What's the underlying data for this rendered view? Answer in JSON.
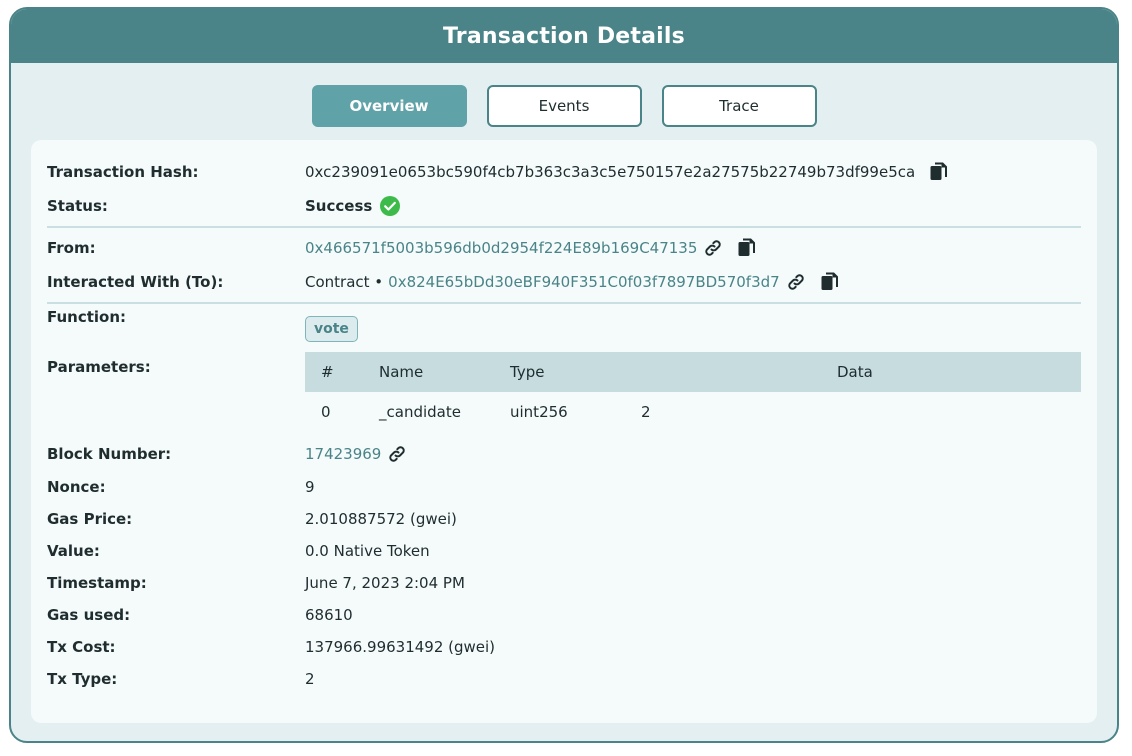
{
  "header": {
    "title": "Transaction Details"
  },
  "tabs": [
    {
      "label": "Overview",
      "active": true
    },
    {
      "label": "Events",
      "active": false
    },
    {
      "label": "Trace",
      "active": false
    }
  ],
  "details": {
    "hash": {
      "label": "Transaction Hash:",
      "value": "0xc239091e0653bc590f4cb7b363c3a3c5e750157e2a27575b22749b73df99e5ca"
    },
    "status": {
      "label": "Status:",
      "value": "Success"
    },
    "from": {
      "label": "From:",
      "value": "0x466571f5003b596db0d2954f224E89b169C47135"
    },
    "to": {
      "label": "Interacted With (To):",
      "prefix": "Contract •",
      "value": "0x824E65bDd30eBF940F351C0f03f7897BD570f3d7"
    },
    "function": {
      "label": "Function:",
      "value": "vote"
    },
    "parameters": {
      "label": "Parameters:",
      "columns": [
        "#",
        "Name",
        "Type",
        "Data"
      ],
      "rows": [
        {
          "index": "0",
          "name": "_candidate",
          "type": "uint256",
          "data": "2"
        }
      ]
    },
    "block": {
      "label": "Block Number:",
      "value": "17423969"
    },
    "nonce": {
      "label": "Nonce:",
      "value": "9"
    },
    "gas_price": {
      "label": "Gas Price:",
      "value": "2.010887572 (gwei)"
    },
    "value": {
      "label": "Value:",
      "value": "0.0 Native Token"
    },
    "timestamp": {
      "label": "Timestamp:",
      "value": "June 7, 2023 2:04 PM"
    },
    "gas_used": {
      "label": "Gas used:",
      "value": "68610"
    },
    "tx_cost": {
      "label": "Tx Cost:",
      "value": "137966.99631492 (gwei)"
    },
    "tx_type": {
      "label": "Tx Type:",
      "value": "2"
    }
  },
  "icons": {
    "copy": "copy-icon",
    "link": "link-icon",
    "success": "check-circle-icon"
  },
  "colors": {
    "accent": "#4a8488",
    "success": "#3dbb4a"
  }
}
